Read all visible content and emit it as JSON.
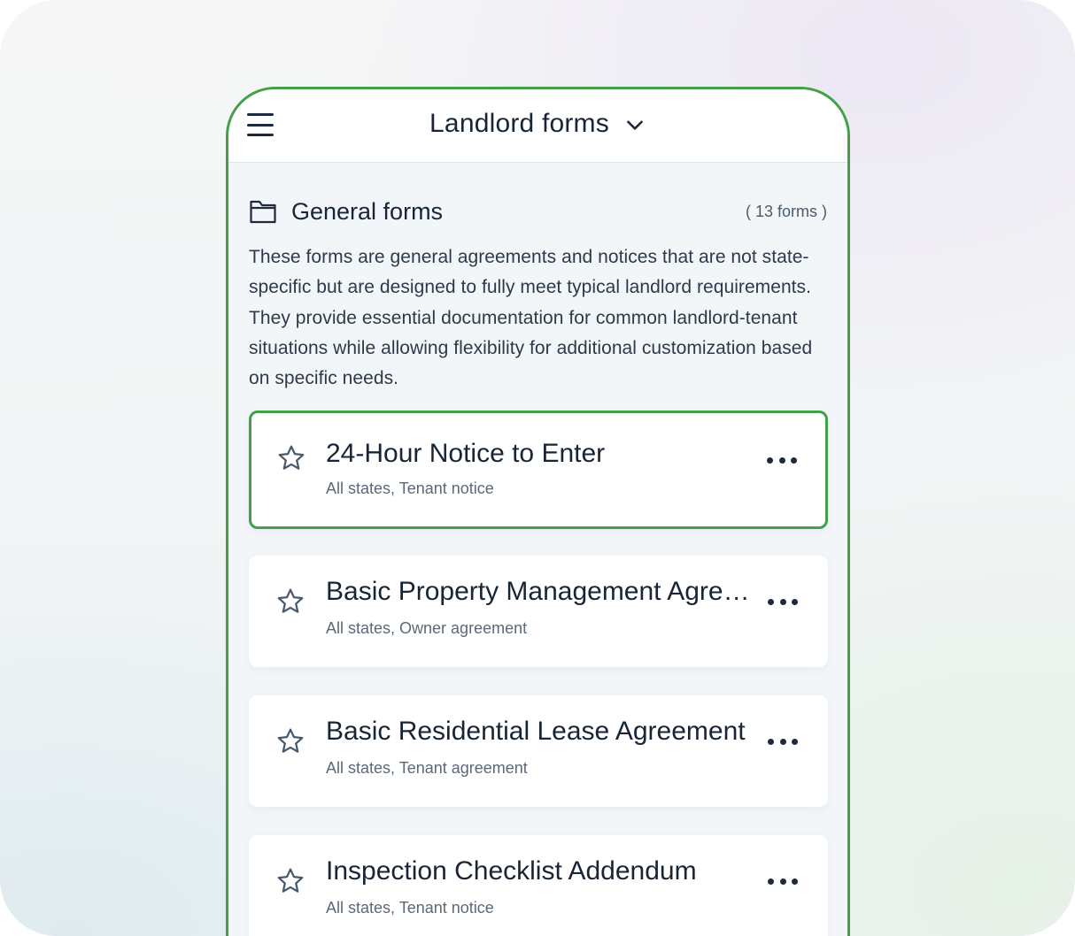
{
  "header": {
    "title": "Landlord forms"
  },
  "section": {
    "title": "General forms",
    "count": "( 13 forms )",
    "description": "These forms are general agreements and notices that are not state-specific but are designed to fully meet typical landlord requirements. They provide essential documentation for common landlord-tenant situations while allowing flexibility for additional customization based on specific needs."
  },
  "forms": [
    {
      "name": "24-Hour Notice to Enter",
      "meta": "All states, Tenant notice",
      "selected": true
    },
    {
      "name": "Basic Property Management Agreement",
      "meta": "All states, Owner agreement",
      "selected": false
    },
    {
      "name": "Basic Residential Lease Agreement",
      "meta": "All states, Tenant agreement",
      "selected": false
    },
    {
      "name": "Inspection Checklist Addendum",
      "meta": "All states, Tenant notice",
      "selected": false
    }
  ],
  "colors": {
    "accent": "#44a046",
    "text": "#172536",
    "muted": "#5b6979"
  },
  "icons": {
    "menu": "hamburger-menu-icon",
    "dropdown": "chevron-down-icon",
    "folder": "folder-icon",
    "favorite": "star-outline-icon",
    "more": "more-horizontal-icon"
  }
}
